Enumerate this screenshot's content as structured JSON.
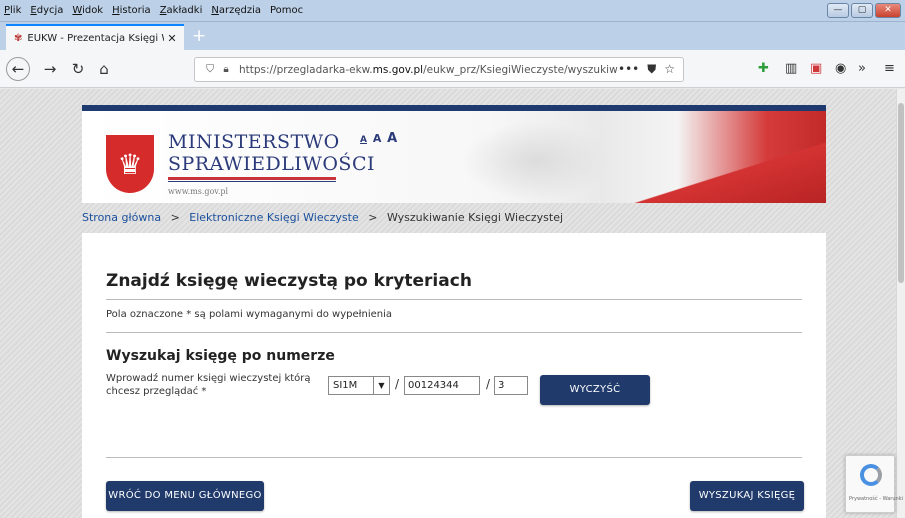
{
  "menubar": {
    "items": [
      {
        "key": "P",
        "rest": "lik"
      },
      {
        "key": "E",
        "rest": "dycja"
      },
      {
        "key": "W",
        "rest": "idok"
      },
      {
        "key": "H",
        "rest": "istoria"
      },
      {
        "key": "Z",
        "rest": "akładki"
      },
      {
        "key": "N",
        "rest": "arzędzia"
      },
      {
        "key": "",
        "rest": "Pomoc"
      }
    ]
  },
  "tab": {
    "title": "EUKW - Prezentacja Księgi Wiec",
    "close": "✕",
    "new_tab": "+"
  },
  "address_bar": {
    "url_prefix": "https://przegladarka-ekw.",
    "url_domain": "ms.gov.pl",
    "url_suffix": "/eukw_prz/KsiegiWieczyste/wyszukiwan",
    "more": "•••"
  },
  "header": {
    "ministry_line1": "MINISTERSTWO",
    "ministry_line2": "SPRAWIEDLIWOŚCI",
    "ministry_url": "www.ms.gov.pl",
    "font_small": "A",
    "font_medium": "A",
    "font_large": "A"
  },
  "breadcrumb": {
    "home": "Strona główna",
    "section": "Elektroniczne Księgi Wieczyste",
    "current": "Wyszukiwanie Księgi Wieczystej",
    "separator": ">"
  },
  "form": {
    "page_title": "Znajdź księgę wieczystą po kryteriach",
    "required_note": "Pola oznaczone * są polami wymaganymi do wypełnienia",
    "section_title": "Wyszukaj księgę po numerze",
    "field_label": "Wprowadź numer księgi wieczystej którą chcesz przeglądać *",
    "court_code": "SI1M",
    "slash": "/",
    "book_number": "00124344",
    "check_digit": "3",
    "clear_button": "WYCZYŚĆ",
    "back_button": "WRÓĆ DO MENU GŁÓWNEGO",
    "search_button": "WYSZUKAJ KSIĘGĘ"
  },
  "recaptcha": {
    "text": "Prywatność - Warunki"
  },
  "colors": {
    "primary_button": "#1f3a6b",
    "link": "#1a4f9c",
    "accent_red": "#c8343b"
  }
}
